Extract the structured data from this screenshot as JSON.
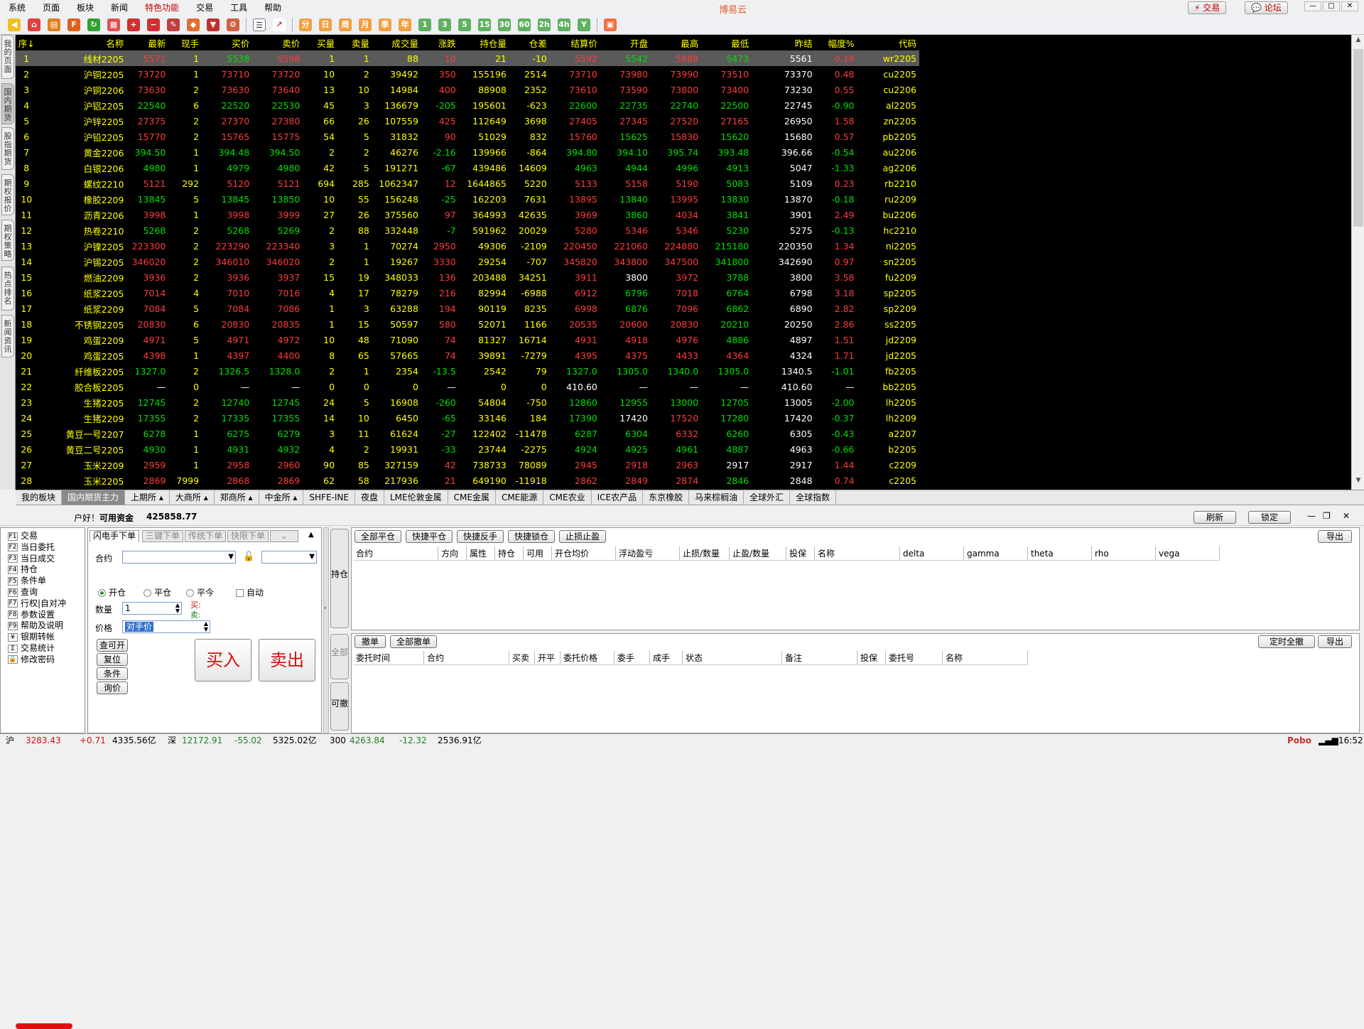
{
  "menu": [
    "系统",
    "页面",
    "板块",
    "新闻",
    "特色功能",
    "交易",
    "工具",
    "帮助"
  ],
  "app_title": "博易云",
  "top_buttons": {
    "trade": "⚡ 交易",
    "forum": "💬 论坛"
  },
  "side_tabs": [
    "我的页面",
    "国内期货",
    "股指期货",
    "期权报价",
    "期权策略",
    "热点排名",
    "新闻资讯"
  ],
  "columns": [
    "序↓",
    "名称",
    "最新",
    "现手",
    "买价",
    "卖价",
    "买量",
    "卖量",
    "成交量",
    "涨跌",
    "持仓量",
    "仓差",
    "结算价",
    "开盘",
    "最高",
    "最低",
    "昨结",
    "幅度%",
    "代码"
  ],
  "rows": [
    [
      "1",
      "线材2205",
      "5571",
      "1",
      "5538",
      "5598",
      "1",
      "1",
      "88",
      "10",
      "21",
      "-10",
      "5592",
      "5542",
      "5888",
      "5473",
      "5561",
      "0.18",
      "wr2205"
    ],
    [
      "2",
      "沪铜2205",
      "73720",
      "1",
      "73710",
      "73720",
      "10",
      "2",
      "39492",
      "350",
      "155196",
      "2514",
      "73710",
      "73980",
      "73990",
      "73510",
      "73370",
      "0.48",
      "cu2205"
    ],
    [
      "3",
      "沪铜2206",
      "73630",
      "2",
      "73630",
      "73640",
      "13",
      "10",
      "14984",
      "400",
      "88908",
      "2352",
      "73610",
      "73590",
      "73800",
      "73400",
      "73230",
      "0.55",
      "cu2206"
    ],
    [
      "4",
      "沪铝2205",
      "22540",
      "6",
      "22520",
      "22530",
      "45",
      "3",
      "136679",
      "-205",
      "195601",
      "-623",
      "22600",
      "22735",
      "22740",
      "22500",
      "22745",
      "-0.90",
      "al2205"
    ],
    [
      "5",
      "沪锌2205",
      "27375",
      "2",
      "27370",
      "27380",
      "66",
      "26",
      "107559",
      "425",
      "112649",
      "3698",
      "27405",
      "27345",
      "27520",
      "27165",
      "26950",
      "1.58",
      "zn2205"
    ],
    [
      "6",
      "沪铅2205",
      "15770",
      "2",
      "15765",
      "15775",
      "54",
      "5",
      "31832",
      "90",
      "51029",
      "832",
      "15760",
      "15625",
      "15830",
      "15620",
      "15680",
      "0.57",
      "pb2205"
    ],
    [
      "7",
      "黄金2206",
      "394.50",
      "1",
      "394.48",
      "394.50",
      "2",
      "2",
      "46276",
      "-2.16",
      "139966",
      "-864",
      "394.80",
      "394.10",
      "395.74",
      "393.48",
      "396.66",
      "-0.54",
      "au2206"
    ],
    [
      "8",
      "白银2206",
      "4980",
      "1",
      "4979",
      "4980",
      "42",
      "5",
      "191271",
      "-67",
      "439486",
      "14609",
      "4963",
      "4944",
      "4996",
      "4913",
      "5047",
      "-1.33",
      "ag2206"
    ],
    [
      "9",
      "螺纹2210",
      "5121",
      "292",
      "5120",
      "5121",
      "694",
      "285",
      "1062347",
      "12",
      "1644865",
      "5220",
      "5133",
      "5158",
      "5190",
      "5083",
      "5109",
      "0.23",
      "rb2210"
    ],
    [
      "10",
      "橡胶2209",
      "13845",
      "5",
      "13845",
      "13850",
      "10",
      "55",
      "156248",
      "-25",
      "162203",
      "7631",
      "13895",
      "13840",
      "13995",
      "13830",
      "13870",
      "-0.18",
      "ru2209"
    ],
    [
      "11",
      "沥青2206",
      "3998",
      "1",
      "3998",
      "3999",
      "27",
      "26",
      "375560",
      "97",
      "364993",
      "42635",
      "3969",
      "3860",
      "4034",
      "3841",
      "3901",
      "2.49",
      "bu2206"
    ],
    [
      "12",
      "热卷2210",
      "5268",
      "2",
      "5268",
      "5269",
      "2",
      "88",
      "332448",
      "-7",
      "591962",
      "20029",
      "5280",
      "5346",
      "5346",
      "5230",
      "5275",
      "-0.13",
      "hc2210"
    ],
    [
      "13",
      "沪镍2205",
      "223300",
      "2",
      "223290",
      "223340",
      "3",
      "1",
      "70274",
      "2950",
      "49306",
      "-2109",
      "220450",
      "221060",
      "224880",
      "215180",
      "220350",
      "1.34",
      "ni2205"
    ],
    [
      "14",
      "沪锡2205",
      "346020",
      "2",
      "346010",
      "346020",
      "2",
      "1",
      "19267",
      "3330",
      "29254",
      "-707",
      "345820",
      "343800",
      "347500",
      "341800",
      "342690",
      "0.97",
      "sn2205"
    ],
    [
      "15",
      "燃油2209",
      "3936",
      "2",
      "3936",
      "3937",
      "15",
      "19",
      "348033",
      "136",
      "203488",
      "34251",
      "3911",
      "3800",
      "3972",
      "3788",
      "3800",
      "3.58",
      "fu2209"
    ],
    [
      "16",
      "纸浆2205",
      "7014",
      "4",
      "7010",
      "7016",
      "4",
      "17",
      "78279",
      "216",
      "82994",
      "-6988",
      "6912",
      "6796",
      "7018",
      "6764",
      "6798",
      "3.18",
      "sp2205"
    ],
    [
      "17",
      "纸浆2209",
      "7084",
      "5",
      "7084",
      "7086",
      "1",
      "3",
      "63288",
      "194",
      "90119",
      "8235",
      "6998",
      "6876",
      "7096",
      "6862",
      "6890",
      "2.82",
      "sp2209"
    ],
    [
      "18",
      "不锈钢2205",
      "20830",
      "6",
      "20830",
      "20835",
      "1",
      "15",
      "50597",
      "580",
      "52071",
      "1166",
      "20535",
      "20600",
      "20830",
      "20210",
      "20250",
      "2.86",
      "ss2205"
    ],
    [
      "19",
      "鸡蛋2209",
      "4971",
      "5",
      "4971",
      "4972",
      "10",
      "48",
      "71090",
      "74",
      "81327",
      "16714",
      "4931",
      "4918",
      "4976",
      "4886",
      "4897",
      "1.51",
      "jd2209"
    ],
    [
      "20",
      "鸡蛋2205",
      "4398",
      "1",
      "4397",
      "4400",
      "8",
      "65",
      "57665",
      "74",
      "39891",
      "-7279",
      "4395",
      "4375",
      "4433",
      "4364",
      "4324",
      "1.71",
      "jd2205"
    ],
    [
      "21",
      "纤维板2205",
      "1327.0",
      "2",
      "1326.5",
      "1328.0",
      "2",
      "1",
      "2354",
      "-13.5",
      "2542",
      "79",
      "1327.0",
      "1305.0",
      "1340.0",
      "1305.0",
      "1340.5",
      "-1.01",
      "fb2205"
    ],
    [
      "22",
      "胶合板2205",
      "—",
      "0",
      "—",
      "—",
      "0",
      "0",
      "0",
      "—",
      "0",
      "0",
      "410.60",
      "—",
      "—",
      "—",
      "410.60",
      "—",
      "bb2205"
    ],
    [
      "23",
      "生猪2205",
      "12745",
      "2",
      "12740",
      "12745",
      "24",
      "5",
      "16908",
      "-260",
      "54804",
      "-750",
      "12860",
      "12955",
      "13000",
      "12705",
      "13005",
      "-2.00",
      "lh2205"
    ],
    [
      "24",
      "生猪2209",
      "17355",
      "2",
      "17335",
      "17355",
      "14",
      "10",
      "6450",
      "-65",
      "33146",
      "184",
      "17390",
      "17420",
      "17520",
      "17280",
      "17420",
      "-0.37",
      "lh2209"
    ],
    [
      "25",
      "黄豆一号2207",
      "6278",
      "1",
      "6275",
      "6279",
      "3",
      "11",
      "61624",
      "-27",
      "122402",
      "-11478",
      "6287",
      "6304",
      "6332",
      "6260",
      "6305",
      "-0.43",
      "a2207"
    ],
    [
      "26",
      "黄豆二号2205",
      "4930",
      "1",
      "4931",
      "4932",
      "4",
      "2",
      "19931",
      "-33",
      "23744",
      "-2275",
      "4924",
      "4925",
      "4961",
      "4887",
      "4963",
      "-0.66",
      "b2205"
    ],
    [
      "27",
      "玉米2209",
      "2959",
      "1",
      "2958",
      "2960",
      "90",
      "85",
      "327159",
      "42",
      "738733",
      "78089",
      "2945",
      "2918",
      "2963",
      "2917",
      "2917",
      "1.44",
      "c2209"
    ],
    [
      "28",
      "玉米2205",
      "2869",
      "7999",
      "2868",
      "2869",
      "62",
      "58",
      "217936",
      "21",
      "649190",
      "-11918",
      "2862",
      "2849",
      "2874",
      "2846",
      "2848",
      "0.74",
      "c2205"
    ]
  ],
  "board_tabs": [
    "我的板块",
    "国内期货主力",
    "上期所 ▴",
    "大商所 ▴",
    "郑商所 ▴",
    "中金所 ▴",
    "SHFE-INE",
    "夜盘",
    "LME伦敦金属",
    "CME金属",
    "CME能源",
    "CME农业",
    "ICE农产品",
    "东京橡胶",
    "马来棕榈油",
    "全球外汇",
    "全球指数"
  ],
  "trade": {
    "greeting_suffix": "户好！",
    "funds_label": "可用资金",
    "funds_value": "425858.77",
    "refresh": "刷新",
    "lock": "锁定",
    "left_menu": [
      [
        "F1",
        "交易"
      ],
      [
        "F2",
        "当日委托"
      ],
      [
        "F3",
        "当日成交"
      ],
      [
        "F4",
        "持仓"
      ],
      [
        "F5",
        "条件单"
      ],
      [
        "F6",
        "查询"
      ],
      [
        "F7",
        "行权|自对冲"
      ],
      [
        "F8",
        "参数设置"
      ],
      [
        "F9",
        "帮助及说明"
      ],
      [
        "¥",
        "银期转帐"
      ],
      [
        "Σ",
        "交易统计"
      ],
      [
        "🔒",
        "修改密码"
      ]
    ],
    "order_tabs": [
      "闪电手下单",
      "三键下单",
      "传统下单",
      "快限下单"
    ],
    "contract_label": "合约",
    "radios": [
      "开仓",
      "平仓",
      "平今"
    ],
    "auto_label": "自动",
    "qty_label": "数量",
    "qty_value": "1",
    "buy_label": "买:",
    "sell_label": "卖:",
    "price_label": "价格",
    "price_value": "对手价",
    "small_buttons": [
      "查可开",
      "复位",
      "条件",
      "询价"
    ],
    "buy_button": "买入",
    "sell_button": "卖出",
    "vtabs": [
      "持仓",
      "全部",
      "可撤"
    ],
    "pos_buttons": [
      "全部平仓",
      "快捷平仓",
      "快捷反手",
      "快捷锁仓",
      "止损止盈"
    ],
    "export": "导出",
    "pos_headers": [
      "合约",
      "方向",
      "属性",
      "持仓",
      "可用",
      "开仓均价",
      "浮动盈亏",
      "止损/数量",
      "止盈/数量",
      "投保",
      "名称",
      "delta",
      "gamma",
      "theta",
      "rho",
      "vega"
    ],
    "ord_buttons": [
      "撤单",
      "全部撤单"
    ],
    "timed_cancel": "定时全撤",
    "ord_headers": [
      "委托时间",
      "合约",
      "买卖",
      "开平",
      "委托价格",
      "委手",
      "成手",
      "状态",
      "备注",
      "投保",
      "委托号",
      "名称"
    ]
  },
  "status": {
    "sh_label": "沪",
    "sh_value": "3283.43",
    "sh_change": "+0.71",
    "sh_amount": "4335.56亿",
    "sz_label": "深",
    "sz_value": "12172.91",
    "sz_change": "-55.02",
    "sz_amount": "5325.02亿",
    "c300_label": "300",
    "c300_value": "4263.84",
    "c300_change": "-12.32",
    "c300_amount": "2536.91亿",
    "brand": "Pobo",
    "time": "16:52"
  }
}
